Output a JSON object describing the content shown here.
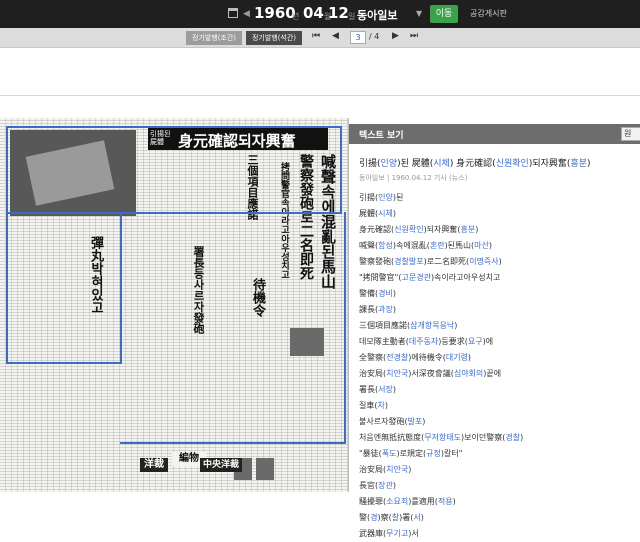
{
  "date": {
    "year": "1960",
    "year_unit": "년",
    "month": "04",
    "month_unit": "월",
    "day": "12",
    "day_unit": "일"
  },
  "newspaper": "동아일보",
  "go_label": "이동",
  "notice_label": "공감게시판",
  "toolbar": {
    "tab_morning": "정기발행(조간)",
    "tab_evening": "정기발행(석간)",
    "page_current": "3",
    "page_total": "/ 4"
  },
  "scan": {
    "headline_main": "身元確認되자興奮",
    "headline_small": "引揚된屍體",
    "vertical_1": "喊聲속에混亂된馬山",
    "vertical_2": "警察發砲로二名即死",
    "vertical_3": "拷問警官속이라고아우성치고",
    "vertical_4": "彈丸박혀있고",
    "vertical_5": "三個項目應諾",
    "vertical_6": "署長등사르자發砲",
    "vertical_7": "待機令",
    "ad_1": "洋裁",
    "ad_2": "編物",
    "ad_3": "中央洋裁"
  },
  "panel": {
    "title": "텍스트 보기",
    "button": "원",
    "article_title": [
      {
        "t": "引揚("
      },
      {
        "t": "인양",
        "r": true
      },
      {
        "t": ")된 屍體("
      },
      {
        "t": "시체",
        "r": true
      },
      {
        "t": ") 身元確認("
      },
      {
        "t": "신원확인",
        "r": true
      },
      {
        "t": ")되자興奮("
      },
      {
        "t": "흥분",
        "r": true
      },
      {
        "t": ")"
      }
    ],
    "meta": "동아일보 | 1960.04.12 기사 (뉴스)",
    "lines": [
      [
        {
          "t": "引揚("
        },
        {
          "t": "인양",
          "r": true
        },
        {
          "t": ")된"
        }
      ],
      [
        {
          "t": "屍體("
        },
        {
          "t": "시체",
          "r": true
        },
        {
          "t": ")"
        }
      ],
      [
        {
          "t": "身元確認("
        },
        {
          "t": "신원확인",
          "r": true
        },
        {
          "t": ")되자興奮("
        },
        {
          "t": "흥분",
          "r": true
        },
        {
          "t": ")"
        }
      ],
      [
        {
          "t": "喊聲("
        },
        {
          "t": "함성",
          "r": true
        },
        {
          "t": ")속에混亂("
        },
        {
          "t": "혼란",
          "r": true
        },
        {
          "t": ")된馬山("
        },
        {
          "t": "마산",
          "r": true
        },
        {
          "t": ")"
        }
      ],
      [
        {
          "t": "警察發砲("
        },
        {
          "t": "경찰발포",
          "r": true
        },
        {
          "t": ")로二名即死("
        },
        {
          "t": "이명즉사",
          "r": true
        },
        {
          "t": ")"
        }
      ],
      [
        {
          "t": "\"拷問警官\"("
        },
        {
          "t": "고문경관",
          "r": true
        },
        {
          "t": ")속이라"
        },
        {
          "t": "고",
          "r": false
        },
        {
          "t": "아우성치고"
        }
      ],
      [
        {
          "t": "警備("
        },
        {
          "t": "경비",
          "r": true
        },
        {
          "t": ")"
        }
      ],
      [
        {
          "t": "課長("
        },
        {
          "t": "과장",
          "r": true
        },
        {
          "t": ")"
        }
      ],
      [
        {
          "t": "三個項目應諾("
        },
        {
          "t": "삼개항목응낙",
          "r": true
        },
        {
          "t": ")"
        }
      ],
      [
        {
          "t": "데모隊主動者("
        },
        {
          "t": "데주동자",
          "r": true
        },
        {
          "t": ")등要求("
        },
        {
          "t": "요구",
          "r": true
        },
        {
          "t": ")에"
        }
      ],
      [
        {
          "t": "全警察("
        },
        {
          "t": "전경찰",
          "r": true
        },
        {
          "t": ")에待機令("
        },
        {
          "t": "대기령",
          "r": true
        },
        {
          "t": ")"
        }
      ],
      [
        {
          "t": "治安局("
        },
        {
          "t": "치안국",
          "r": true
        },
        {
          "t": ")서深夜會議("
        },
        {
          "t": "심야회의",
          "r": true
        },
        {
          "t": ")끝에"
        }
      ],
      [
        {
          "t": "署長("
        },
        {
          "t": "서장",
          "r": true
        },
        {
          "t": ")"
        }
      ],
      [
        {
          "t": "질車("
        },
        {
          "t": "차",
          "r": true
        },
        {
          "t": ")"
        }
      ],
      [
        {
          "t": "불사르자發砲("
        },
        {
          "t": "발포",
          "r": true
        },
        {
          "t": ")"
        }
      ],
      [
        {
          "t": "처음엔無抵抗態度("
        },
        {
          "t": "무저항태도",
          "r": true
        },
        {
          "t": ")보이던警察("
        },
        {
          "t": "경찰",
          "r": true
        },
        {
          "t": ")"
        }
      ],
      [
        {
          "t": "\"暴徒("
        },
        {
          "t": "폭도",
          "r": true
        },
        {
          "t": ")로規定("
        },
        {
          "t": "규정",
          "r": true
        },
        {
          "t": ")칼터\""
        }
      ],
      [
        {
          "t": "治安局("
        },
        {
          "t": "치안국",
          "r": true
        },
        {
          "t": ")"
        }
      ],
      [
        {
          "t": "長官("
        },
        {
          "t": "장관",
          "r": true
        },
        {
          "t": ")"
        }
      ],
      [
        {
          "t": "騷擾罪("
        },
        {
          "t": "소요죄",
          "r": true
        },
        {
          "t": ")를適用("
        },
        {
          "t": "적용",
          "r": true
        },
        {
          "t": ")"
        }
      ],
      [
        {
          "t": "警("
        },
        {
          "t": "경",
          "r": true
        },
        {
          "t": ")察("
        },
        {
          "t": "찰",
          "r": true
        },
        {
          "t": ")署("
        },
        {
          "t": "서",
          "r": true
        },
        {
          "t": ")"
        }
      ],
      [
        {
          "t": "武器庫("
        },
        {
          "t": "무기고",
          "r": true
        },
        {
          "t": ")서"
        }
      ]
    ]
  }
}
